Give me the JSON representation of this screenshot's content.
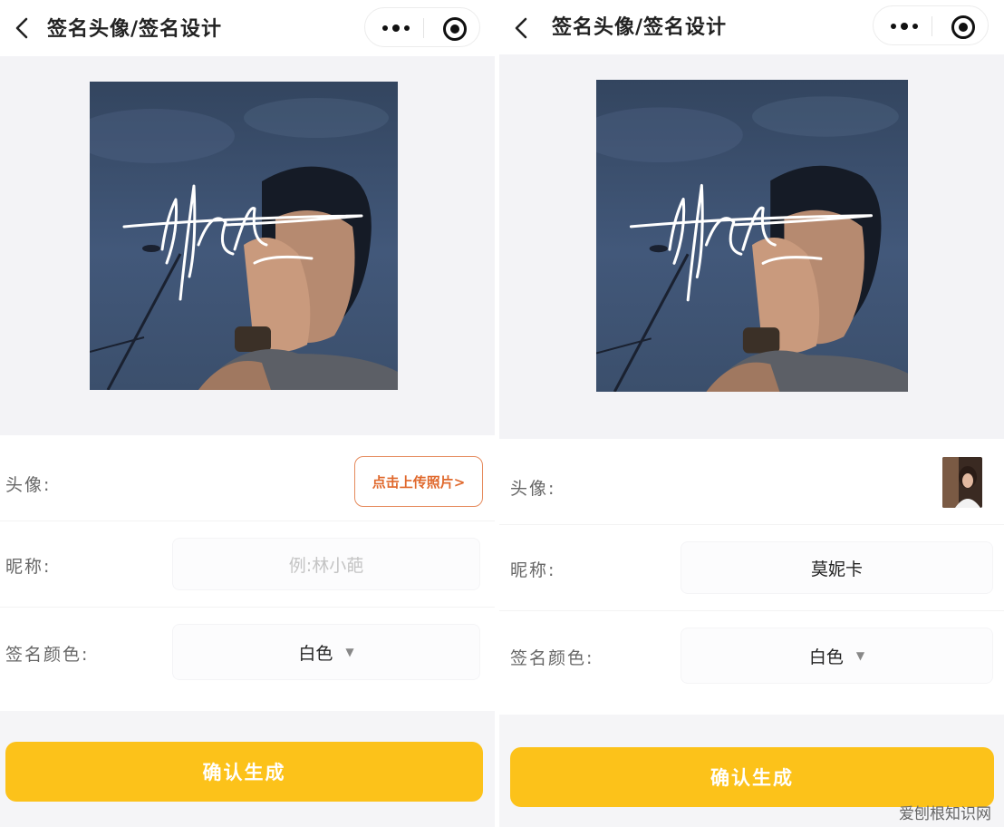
{
  "screens": [
    {
      "nav_title": "签名头像/签名设计",
      "avatar_label": "头像:",
      "upload_button": "点击上传照片>",
      "nickname_label": "昵称:",
      "nickname_placeholder": "例:林小葩",
      "nickname_value": "",
      "color_label": "签名颜色:",
      "color_value": "白色",
      "confirm_button": "确认生成"
    },
    {
      "nav_title": "签名头像/签名设计",
      "avatar_label": "头像:",
      "nickname_label": "昵称:",
      "nickname_value": "莫妮卡",
      "color_label": "签名颜色:",
      "color_value": "白色",
      "confirm_button": "确认生成"
    }
  ],
  "watermark": "爱刨根知识网",
  "colors": {
    "accent": "#fcc21a",
    "upload_border": "#e58a5c",
    "upload_text": "#e0692d",
    "background": "#f5f5f7"
  },
  "icons": [
    "back-arrow-icon",
    "more-dots-icon",
    "target-circle-icon",
    "dropdown-caret-icon"
  ]
}
